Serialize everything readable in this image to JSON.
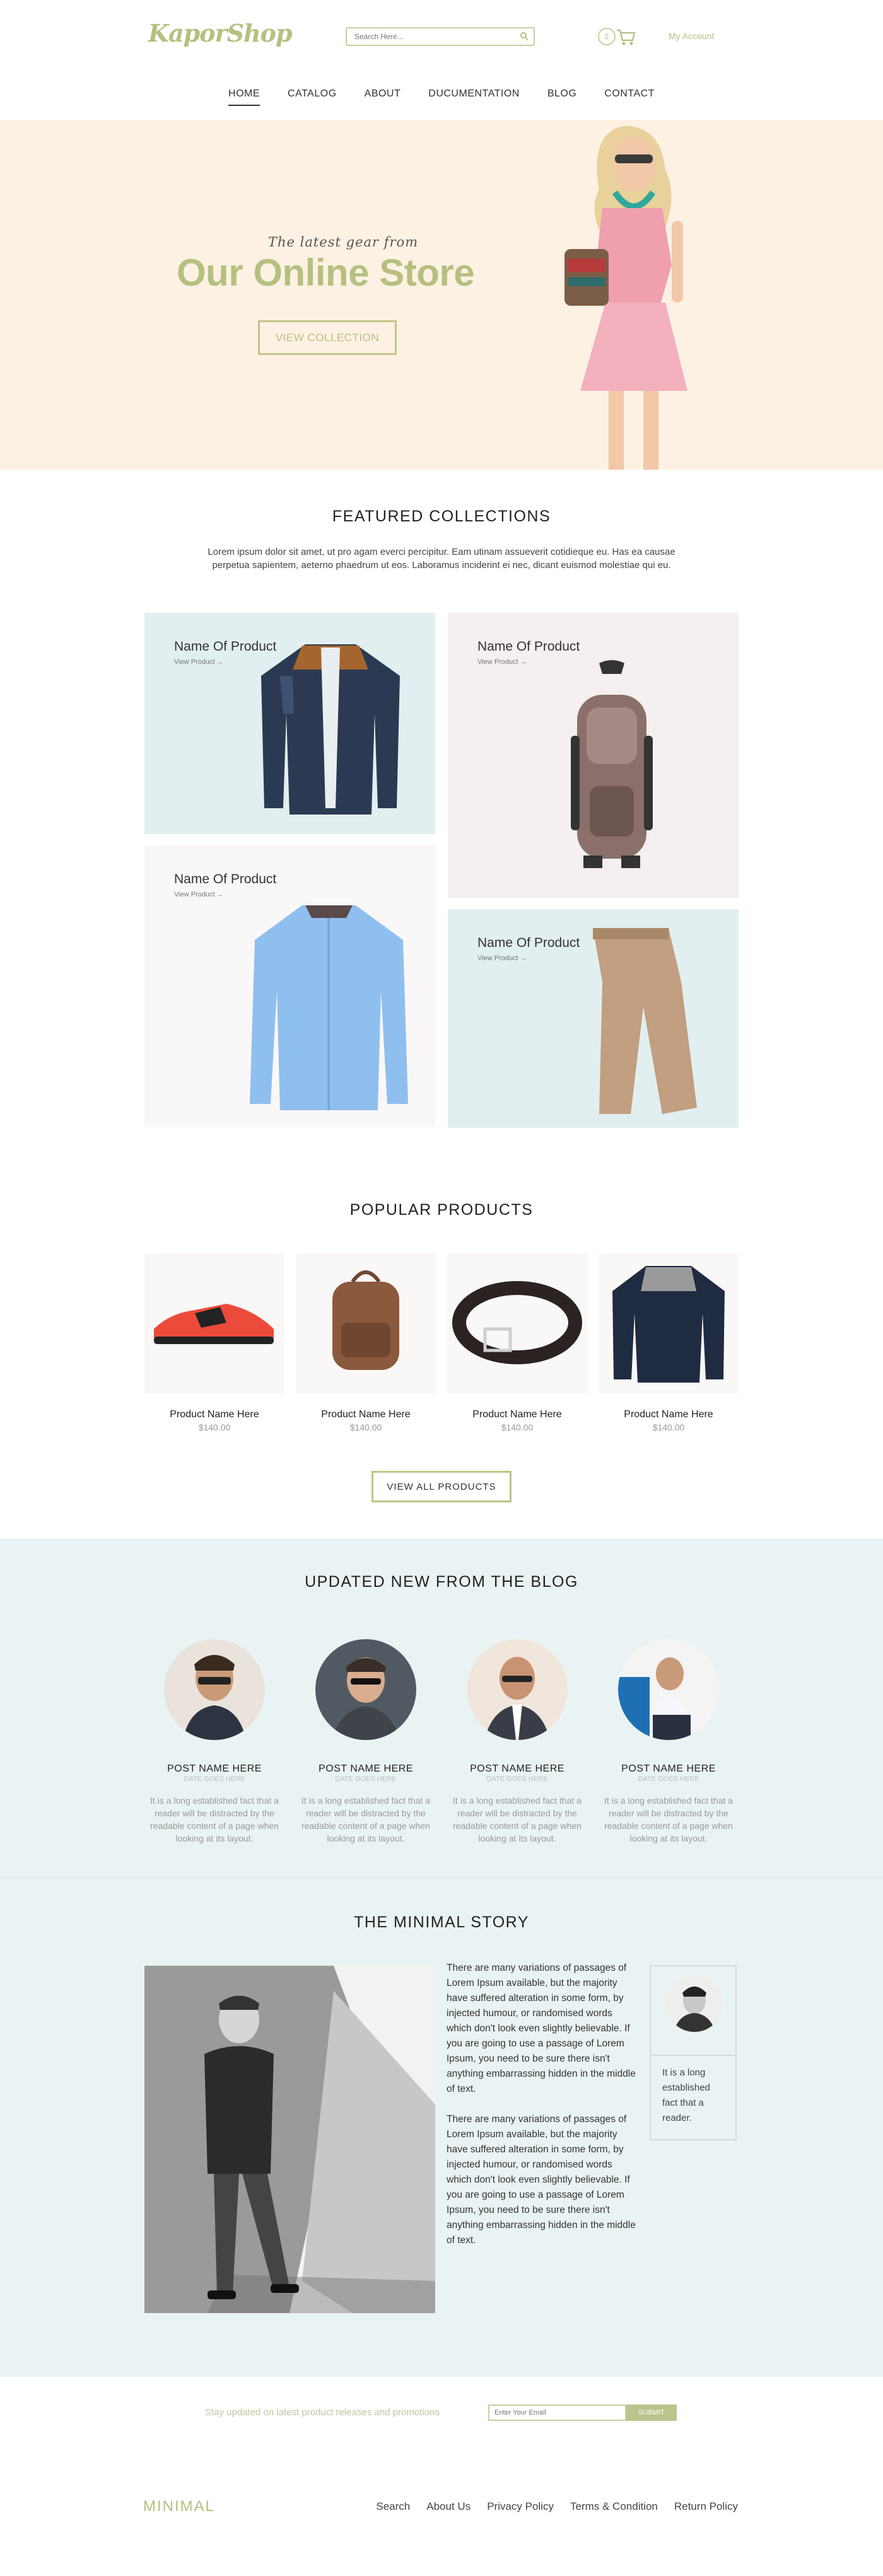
{
  "header": {
    "logo": "KaporShop",
    "search_placeholder": "Search Here...",
    "cart_count": "2",
    "account_label": "My Account"
  },
  "nav": [
    "HOME",
    "CATALOG",
    "ABOUT",
    "DUCUMENTATION",
    "BLOG",
    "CONTACT"
  ],
  "hero": {
    "tagline": "The latest gear from",
    "title": "Our Online Store",
    "button": "VIEW COLLECTION"
  },
  "featured": {
    "title": "FEATURED COLLECTIONS",
    "description": "Lorem ipsum dolor sit amet, ut pro agam everci percipitur. Eam utinam assueverit cotidieque eu. Has ea causae perpetua sapientem, aeterno phaedrum ut eos. Laboramus inciderint ei nec, dicant euismod molestiae qui eu.",
    "items": [
      {
        "name": "Name Of Product",
        "link": "View Product →"
      },
      {
        "name": "Name Of Product",
        "link": "View Product →"
      },
      {
        "name": "Name Of Product",
        "link": "View Product →"
      },
      {
        "name": "Name Of Product",
        "link": "View Product →"
      }
    ]
  },
  "popular": {
    "title": "POPULAR PRODUCTS",
    "items": [
      {
        "name": "Product Name Here",
        "price": "$140.00"
      },
      {
        "name": "Product Name Here",
        "price": "$140.00"
      },
      {
        "name": "Product Name Here",
        "price": "$140.00"
      },
      {
        "name": "Product Name Here",
        "price": "$140.00"
      }
    ],
    "view_all": "VIEW ALL PRODUCTS"
  },
  "blog": {
    "title": "UPDATED NEW FROM THE BLOG",
    "posts": [
      {
        "title": "POST NAME HERE",
        "date": "DATE GOES HERE",
        "text": "It is a long established fact that a reader will be distracted by the readable content of a page when looking at its layout."
      },
      {
        "title": "POST NAME HERE",
        "date": "DATE GOES HERE",
        "text": "It is a long established fact that a reader will be distracted by the readable content of a page when looking at its layout."
      },
      {
        "title": "POST NAME HERE",
        "date": "DATE GOES HERE",
        "text": "It is a long established fact that a reader will be distracted by the readable content of a page when looking at its layout."
      },
      {
        "title": "POST NAME HERE",
        "date": "DATE GOES HERE",
        "text": "It is a long established fact that a reader will be distracted by the readable content of a page when looking at its layout."
      }
    ]
  },
  "story": {
    "title": "THE MINIMAL STORY",
    "paragraphs": [
      "There are many variations of passages of Lorem Ipsum available, but the majority have suffered alteration in some form, by injected humour, or randomised words which don't look even slightly believable. If you are going to use a passage of Lorem Ipsum, you need to be sure there isn't anything embarrassing hidden in the middle of text.",
      "There are many variations of passages of Lorem Ipsum available, but the majority have suffered alteration in some form, by injected humour, or randomised words which don't look even slightly believable. If you are going to use a passage of Lorem Ipsum, you need to be sure there isn't anything embarrassing hidden in the middle of text."
    ],
    "quote": "It is a long established fact that a reader."
  },
  "newsletter": {
    "text": "Stay updated on latest product releases and promotions",
    "placeholder": "Enter Your Email",
    "button": "SUBMIT"
  },
  "footer": {
    "logo": "MINIMAL",
    "links": [
      "Search",
      "About Us",
      "Privacy Policy",
      "Terms & Condition",
      "Return Policy"
    ]
  },
  "colors": {
    "accent": "#b5c080",
    "hero_bg": "#fdf1e3",
    "blog_bg": "#eaf3f4",
    "card_blue": "#e2eff0",
    "card_pink": "#f6efef"
  }
}
